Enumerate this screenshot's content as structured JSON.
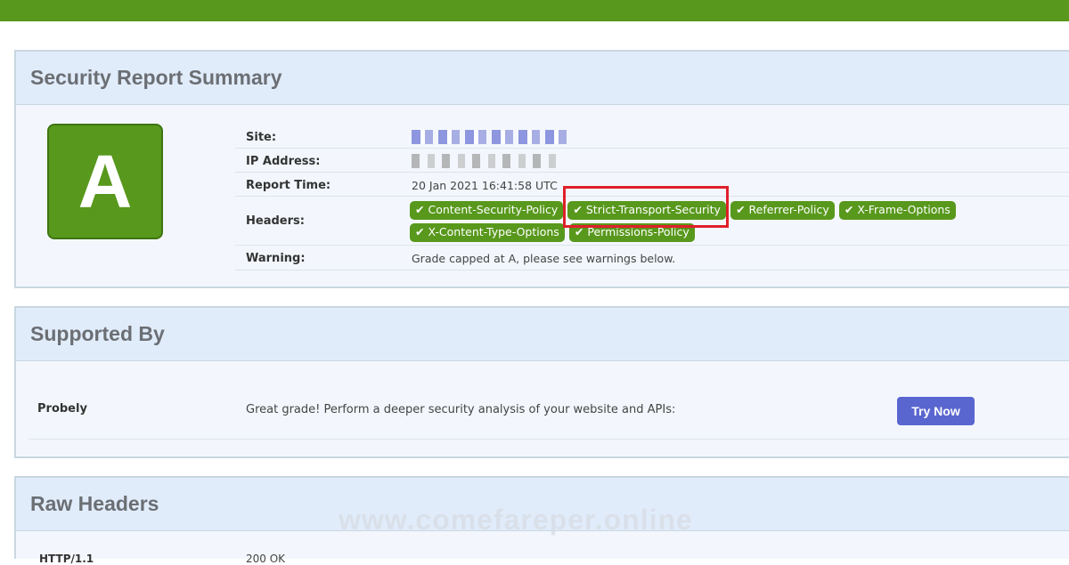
{
  "summary": {
    "title": "Security Report Summary",
    "grade": "A",
    "rows": {
      "site_label": "Site:",
      "ip_label": "IP Address:",
      "time_label": "Report Time:",
      "time_value": "20 Jan 2021 16:41:58 UTC",
      "headers_label": "Headers:",
      "warning_label": "Warning:",
      "warning_value": "Grade capped at A, please see warnings below."
    },
    "headers": [
      "Content-Security-Policy",
      "Strict-Transport-Security",
      "Referrer-Policy",
      "X-Frame-Options",
      "X-Content-Type-Options",
      "Permissions-Policy"
    ],
    "check_glyph": "✔"
  },
  "supported": {
    "title": "Supported By",
    "name": "Probely",
    "text": "Great grade! Perform a deeper security analysis of your website and APIs:",
    "button": "Try Now"
  },
  "raw": {
    "title": "Raw Headers",
    "first_key": "HTTP/1.1",
    "first_value": "200 OK"
  },
  "watermark": "www.comefareper.online",
  "colors": {
    "brand_green": "#58981c",
    "button_blue": "#5a66cf",
    "highlight_red": "#e0202a"
  }
}
